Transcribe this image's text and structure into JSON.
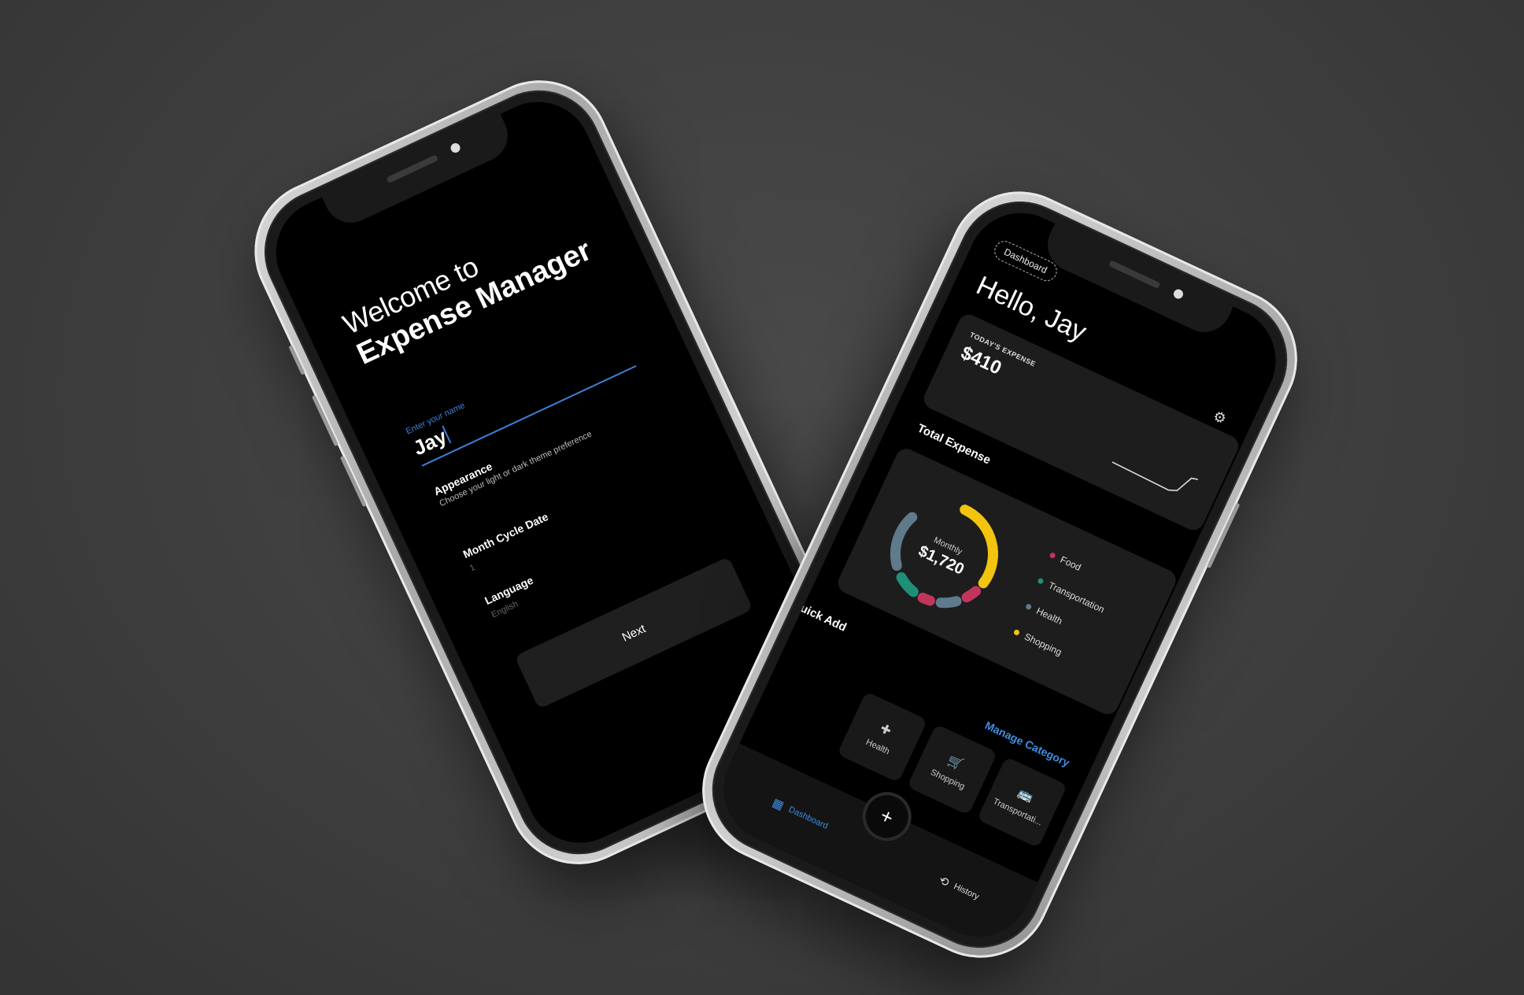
{
  "welcome": {
    "line1": "Welcome to",
    "line2": "Expense Manager",
    "name_label": "Enter your name",
    "name_value": "Jay",
    "appearance_title": "Appearance",
    "appearance_sub": "Choose your light or dark theme preference",
    "month_title": "Month Cycle Date",
    "month_value": "1",
    "language_title": "Language",
    "language_value": "English",
    "next_label": "Next"
  },
  "dashboard": {
    "chip": "Dashboard",
    "greeting": "Hello, Jay",
    "settings_icon": "gear-icon",
    "today_label": "TODAY'S EXPENSE",
    "today_value": "$410",
    "total_title": "Total Expense",
    "donut_label": "Monthly",
    "donut_value": "$1,720",
    "legend": [
      {
        "name": "Food",
        "color": "#c2355a"
      },
      {
        "name": "Transportation",
        "color": "#1f8f7a"
      },
      {
        "name": "Health",
        "color": "#5f7a8a"
      },
      {
        "name": "Shopping",
        "color": "#f2c40f"
      }
    ],
    "quick_add": "Quick Add",
    "manage_category": "Manage Category",
    "tiles": [
      {
        "label": "Health",
        "icon": "health-icon"
      },
      {
        "label": "Shopping",
        "icon": "cart-icon"
      },
      {
        "label": "Transportati...",
        "icon": "bus-icon"
      }
    ],
    "nav": {
      "dashboard": "Dashboard",
      "history": "History",
      "fab": "+"
    },
    "accent": "#3d8ee0"
  }
}
